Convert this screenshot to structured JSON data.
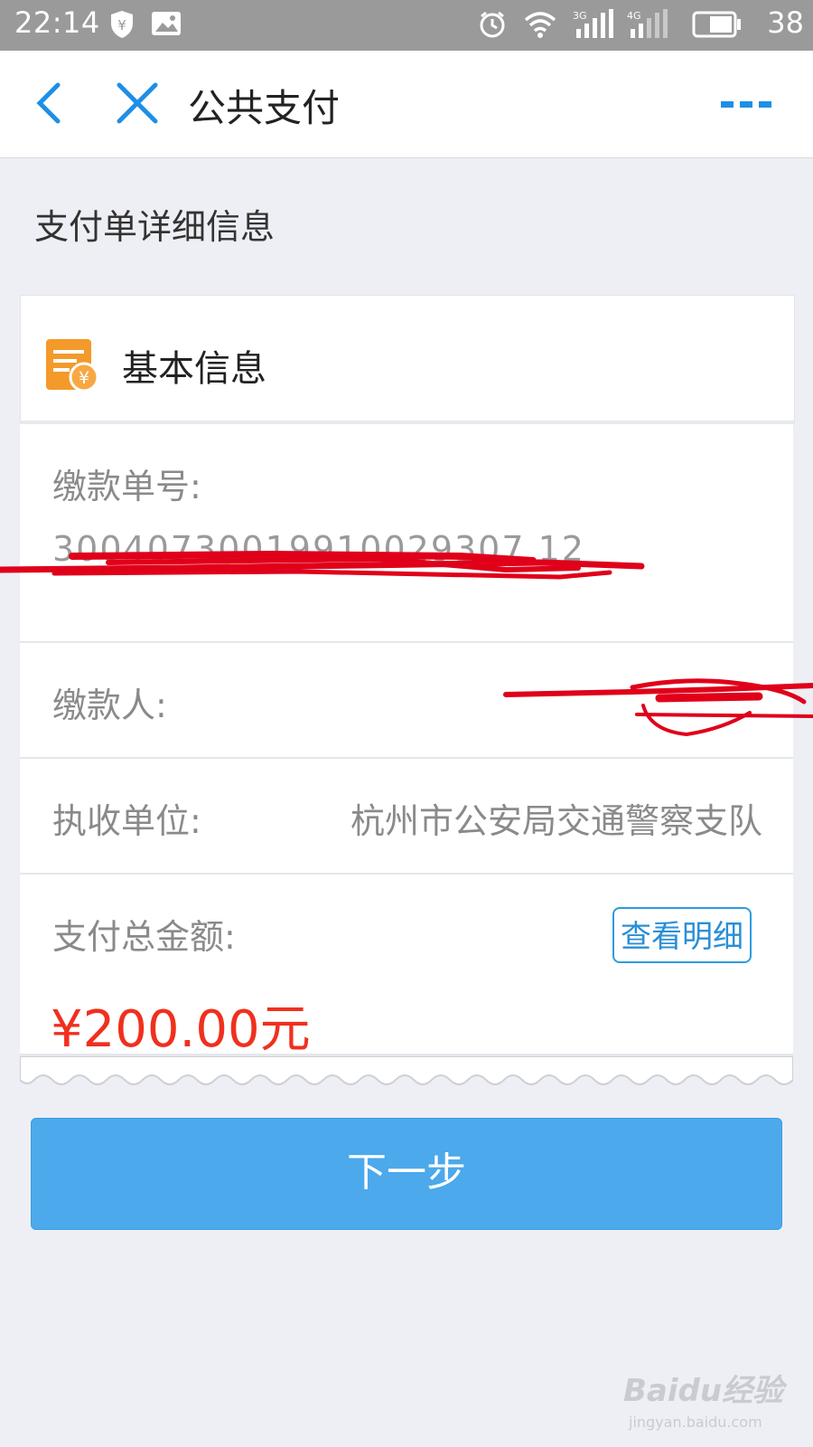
{
  "status_bar": {
    "time": "22:14",
    "net_3g": "3G",
    "net_4g": "4G",
    "battery": "38",
    "icons": [
      "shield-yuan-icon",
      "image-icon",
      "alarm-icon",
      "wifi-icon",
      "signal-3g-icon",
      "signal-4g-icon",
      "battery-icon"
    ]
  },
  "navbar": {
    "title": "公共支付",
    "icons": [
      "back-arrow-icon",
      "close-icon",
      "more-icon"
    ]
  },
  "section_title": "支付单详细信息",
  "basic_info": {
    "header": "基本信息",
    "icon": "bill-yuan-icon",
    "rows": {
      "order_no_label": "缴款单号:",
      "order_no_value": "30040730019910029307 12",
      "payer_label": "缴款人:",
      "agency_label": "执收单位:",
      "agency_value": "杭州市公安局交通警察支队",
      "total_label": "支付总金额:",
      "detail_button": "查看明细",
      "amount": "¥200.00元"
    }
  },
  "next_button": "下一步",
  "watermark": {
    "brand": "Baidu经验",
    "url": "jingyan.baidu.com"
  },
  "colors": {
    "accent": "#2d9bdf",
    "button": "#4ba9ec",
    "amount": "#f0301e",
    "redaction": "#e0001a"
  }
}
